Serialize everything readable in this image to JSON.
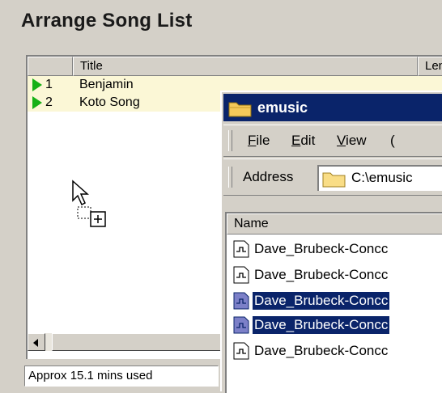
{
  "page": {
    "title": "Arrange Song List"
  },
  "song_list": {
    "columns": [
      "",
      "Title",
      "Leng"
    ],
    "rows": [
      {
        "num": "1",
        "title": "Benjamin"
      },
      {
        "num": "2",
        "title": "Koto Song"
      }
    ]
  },
  "status": {
    "text": "Approx 15.1 mins used"
  },
  "explorer": {
    "title": "emusic",
    "menu": {
      "file": {
        "accel": "F",
        "rest": "ile"
      },
      "edit": {
        "accel": "E",
        "rest": "dit"
      },
      "view": {
        "accel": "V",
        "rest": "iew"
      },
      "more": {
        "accel": "",
        "rest": "("
      }
    },
    "address": {
      "label": "Address",
      "value": "C:\\emusic"
    },
    "file_list": {
      "column": "Name",
      "files": [
        {
          "name": "Dave_Brubeck-Concc",
          "selected": false
        },
        {
          "name": "Dave_Brubeck-Concc",
          "selected": false
        },
        {
          "name": "Dave_Brubeck-Concc",
          "selected": true
        },
        {
          "name": "Dave_Brubeck-Concc",
          "selected": true
        },
        {
          "name": "Dave_Brubeck-Concc",
          "selected": false
        }
      ]
    }
  },
  "icons": {
    "play": "play-triangle-icon",
    "folder": "folder-icon",
    "audio_file": "audio-file-icon",
    "cursor": "drag-copy-cursor-icon"
  },
  "colors": {
    "title_bar": "#0a246a",
    "row_highlight": "#fbf7d6",
    "play_green": "#16b016",
    "selection": "#0a246a"
  }
}
